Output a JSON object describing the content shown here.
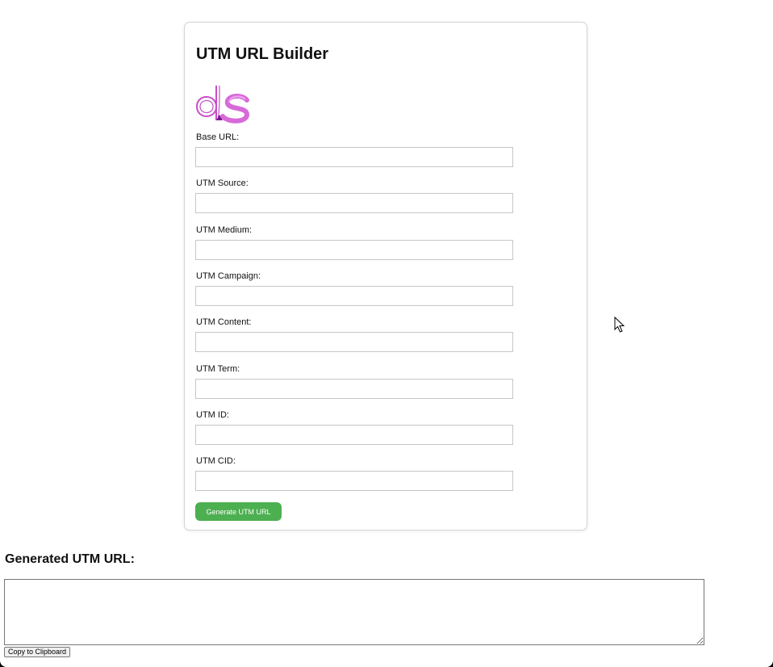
{
  "form": {
    "title": "UTM URL Builder",
    "logo_text": "ds",
    "fields": [
      {
        "label": "Base URL:",
        "value": ""
      },
      {
        "label": "UTM Source:",
        "value": ""
      },
      {
        "label": "UTM Medium:",
        "value": ""
      },
      {
        "label": "UTM Campaign:",
        "value": ""
      },
      {
        "label": "UTM Content:",
        "value": ""
      },
      {
        "label": "UTM Term:",
        "value": ""
      },
      {
        "label": "UTM ID:",
        "value": ""
      },
      {
        "label": "UTM CID:",
        "value": ""
      }
    ],
    "generate_label": "Generate UTM URL"
  },
  "output": {
    "heading": "Generated UTM URL:",
    "value": "",
    "copy_label": "Copy to Clipboard"
  },
  "colors": {
    "accent": "#4caf50",
    "logo": "#c64fc8"
  },
  "icons": {
    "logo": "ds-logo-icon",
    "cursor": "mouse-pointer-icon"
  }
}
